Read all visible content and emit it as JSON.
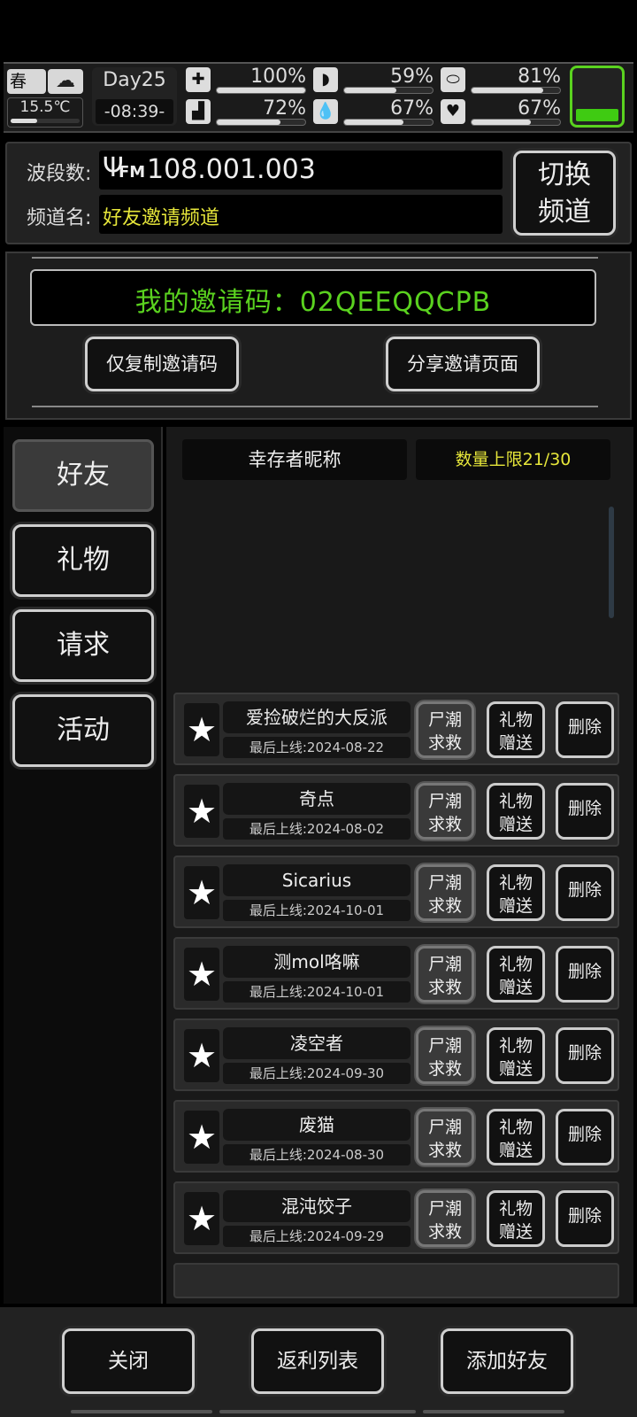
{
  "hud": {
    "season": "春",
    "temperature": "15.5℃",
    "day": "Day25",
    "time": "-08:39-",
    "stats": [
      {
        "icon": "health-kit-icon",
        "glyph": "✚",
        "value": "100%",
        "level": 100
      },
      {
        "icon": "stomach-icon",
        "glyph": "◗",
        "value": "59%",
        "level": 59
      },
      {
        "icon": "capsule-icon",
        "glyph": "⬭",
        "value": "81%",
        "level": 81
      },
      {
        "icon": "boot-icon",
        "glyph": "▟",
        "value": "72%",
        "level": 72
      },
      {
        "icon": "water-drop-icon",
        "glyph": "💧",
        "value": "67%",
        "level": 67
      },
      {
        "icon": "heart-icon",
        "glyph": "♥",
        "value": "67%",
        "level": 67
      }
    ],
    "battery_color": "#3fcb12"
  },
  "radio": {
    "band_label": "波段数:",
    "fm_logo": "FM",
    "band_value": "108.001.003",
    "channel_label": "频道名:",
    "channel_value": "好友邀请频道",
    "switch_button": [
      "切换",
      "频道"
    ]
  },
  "invite": {
    "code_text": "我的邀请码：02QEEQQCPB",
    "copy_button": "仅复制邀请码",
    "share_button": "分享邀请页面"
  },
  "tabs": [
    "好友",
    "礼物",
    "请求",
    "活动"
  ],
  "list_header": {
    "nickname_col": "幸存者昵称",
    "limit": "数量上限21/30"
  },
  "row_buttons": {
    "sos": [
      "尸潮",
      "求救"
    ],
    "gift": [
      "礼物",
      "赠送"
    ],
    "delete": "删除"
  },
  "friends": [
    {
      "name": "爱捡破烂的大反派",
      "last_online": "最后上线:2024-08-22"
    },
    {
      "name": "奇点",
      "last_online": "最后上线:2024-08-02"
    },
    {
      "name": "Sicarius",
      "last_online": "最后上线:2024-10-01"
    },
    {
      "name": "测mol咯嘛",
      "last_online": "最后上线:2024-10-01"
    },
    {
      "name": "凌空者",
      "last_online": "最后上线:2024-09-30"
    },
    {
      "name": "废猫",
      "last_online": "最后上线:2024-08-30"
    },
    {
      "name": "混沌饺子",
      "last_online": "最后上线:2024-09-29"
    }
  ],
  "bottom": {
    "close": "关闭",
    "rebate": "返利列表",
    "add_friend": "添加好友"
  },
  "colors": {
    "accent_green": "#5ad21f",
    "yellow_text": "#e6e63a"
  }
}
